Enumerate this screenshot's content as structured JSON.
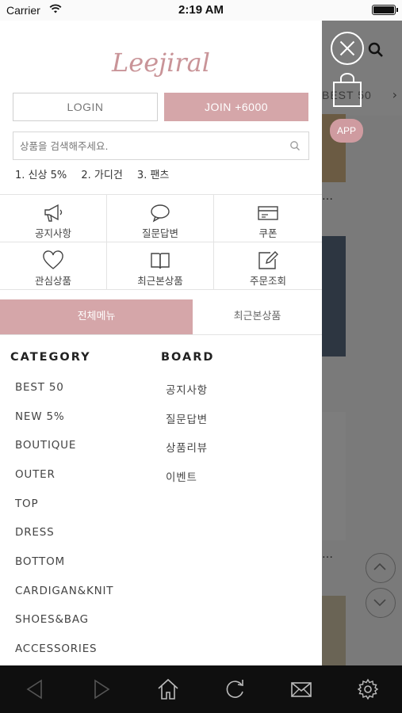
{
  "status_bar": {
    "carrier": "Carrier",
    "time": "2:19 AM"
  },
  "brand": {
    "logo_text": "Leejiral",
    "accent_color": "#d5a6a9"
  },
  "auth": {
    "login_label": "LOGIN",
    "join_label": "JOIN +6000"
  },
  "search": {
    "placeholder": "상품을 검색해주세요."
  },
  "popular_keywords": [
    "1. 신상 5%",
    "2. 가디건",
    "3. 팬츠"
  ],
  "quick_menu": [
    {
      "label": "공지사항",
      "icon": "megaphone-icon"
    },
    {
      "label": "질문답변",
      "icon": "speech-bubble-icon"
    },
    {
      "label": "쿠폰",
      "icon": "coupon-icon"
    },
    {
      "label": "관심상품",
      "icon": "heart-icon"
    },
    {
      "label": "최근본상품",
      "icon": "book-icon"
    },
    {
      "label": "주문조회",
      "icon": "edit-icon"
    }
  ],
  "menu_tabs": {
    "all": "전체메뉴",
    "recent": "최근본상품"
  },
  "category": {
    "title": "CATEGORY",
    "items": [
      "BEST 50",
      "NEW 5%",
      "BOUTIQUE",
      "OUTER",
      "TOP",
      "DRESS",
      "BOTTOM",
      "CARDIGAN&KNIT",
      "SHOES&BAG",
      "ACCESSORIES"
    ]
  },
  "board": {
    "title": "BOARD",
    "items": [
      "공지사항",
      "질문답변",
      "상품리뷰",
      "이벤트"
    ]
  },
  "background_page": {
    "tab_text": "BEST 50",
    "app_badge": "APP"
  },
  "toolbar": {
    "icons": [
      "back-icon",
      "forward-icon",
      "home-icon",
      "refresh-icon",
      "mail-icon",
      "settings-icon"
    ]
  }
}
